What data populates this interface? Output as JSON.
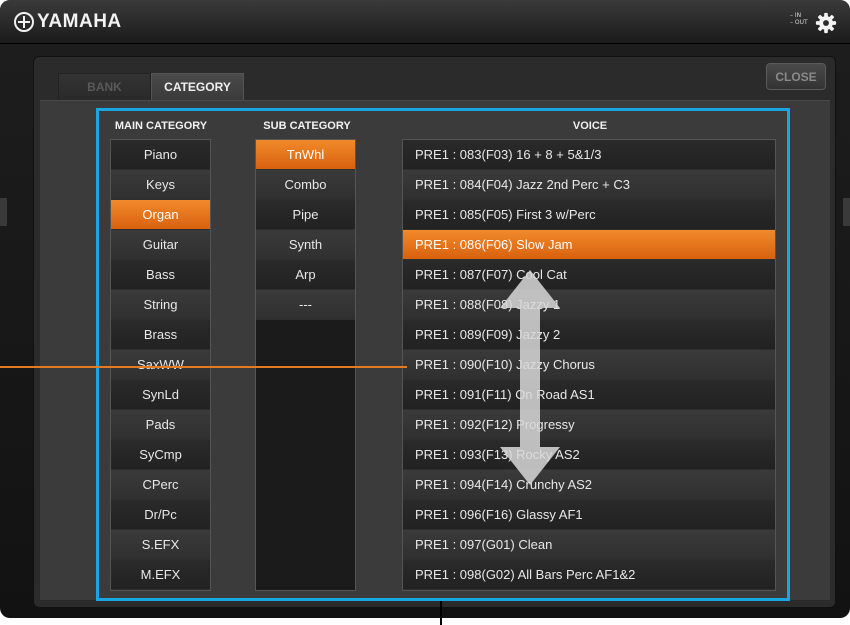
{
  "header": {
    "brand": "YAMAHA",
    "io_in": "– IN",
    "io_out": "– OUT"
  },
  "tabs": [
    {
      "label": "BANK",
      "active": false
    },
    {
      "label": "CATEGORY",
      "active": true
    }
  ],
  "close_label": "CLOSE",
  "columns": {
    "main_header": "MAIN CATEGORY",
    "sub_header": "SUB CATEGORY",
    "voice_header": "VOICE"
  },
  "main_categories": [
    "Piano",
    "Keys",
    "Organ",
    "Guitar",
    "Bass",
    "String",
    "Brass",
    "SaxWW",
    "SynLd",
    "Pads",
    "SyCmp",
    "CPerc",
    "Dr/Pc",
    "S.EFX",
    "M.EFX"
  ],
  "main_selected": "Organ",
  "sub_categories": [
    "TnWhl",
    "Combo",
    "Pipe",
    "Synth",
    "Arp",
    "---"
  ],
  "sub_selected": "TnWhl",
  "voices": [
    "PRE1 : 083(F03) 16 + 8 + 5&1/3",
    "PRE1 : 084(F04) Jazz 2nd Perc + C3",
    "PRE1 : 085(F05) First 3 w/Perc",
    "PRE1 : 086(F06) Slow Jam",
    "PRE1 : 087(F07) Cool Cat",
    "PRE1 : 088(F08) Jazzy 1",
    "PRE1 : 089(F09) Jazzy 2",
    "PRE1 : 090(F10) Jazzy Chorus",
    "PRE1 : 091(F11) On Road AS1",
    "PRE1 : 092(F12) Progressy",
    "PRE1 : 093(F13) Rocky AS2",
    "PRE1 : 094(F14) Crunchy AS2",
    "PRE1 : 096(F16) Glassy AF1",
    "PRE1 : 097(G01) Clean",
    "PRE1 : 098(G02) All Bars Perc AF1&2"
  ],
  "voice_selected": "PRE1 : 086(F06) Slow Jam",
  "icons": {
    "settings": "gear-icon",
    "scroll": "up-down-arrow-icon"
  },
  "colors": {
    "selected": "#e8731a",
    "highlight_frame": "#19a7e1",
    "callout": "#e37b1f"
  }
}
